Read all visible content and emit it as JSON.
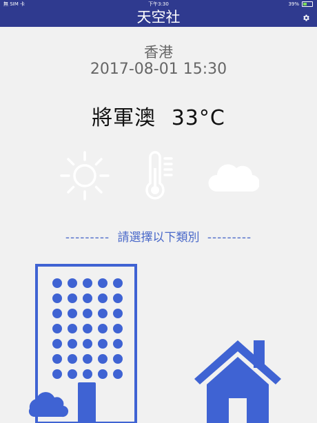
{
  "status_bar": {
    "carrier": "無 SIM 卡",
    "time": "下午3:30",
    "battery": "39%"
  },
  "nav": {
    "title": "天空社"
  },
  "location": {
    "city": "香港",
    "datetime": "2017-08-01 15:30"
  },
  "reading": {
    "station": "將軍澳",
    "temperature": "33°C"
  },
  "icons": [
    "sun-icon",
    "thermometer-icon",
    "cloud-icon",
    "gear-icon"
  ],
  "section": {
    "dashes_left": "---------",
    "prompt": "請選擇以下類別",
    "dashes_right": "---------"
  },
  "categories": [
    "building-category-icon",
    "home-category-icon"
  ],
  "colors": {
    "nav_bg": "#2f3a8f",
    "accent": "#3f63d3",
    "text_gray": "#666666",
    "background": "#f1f1f1"
  }
}
